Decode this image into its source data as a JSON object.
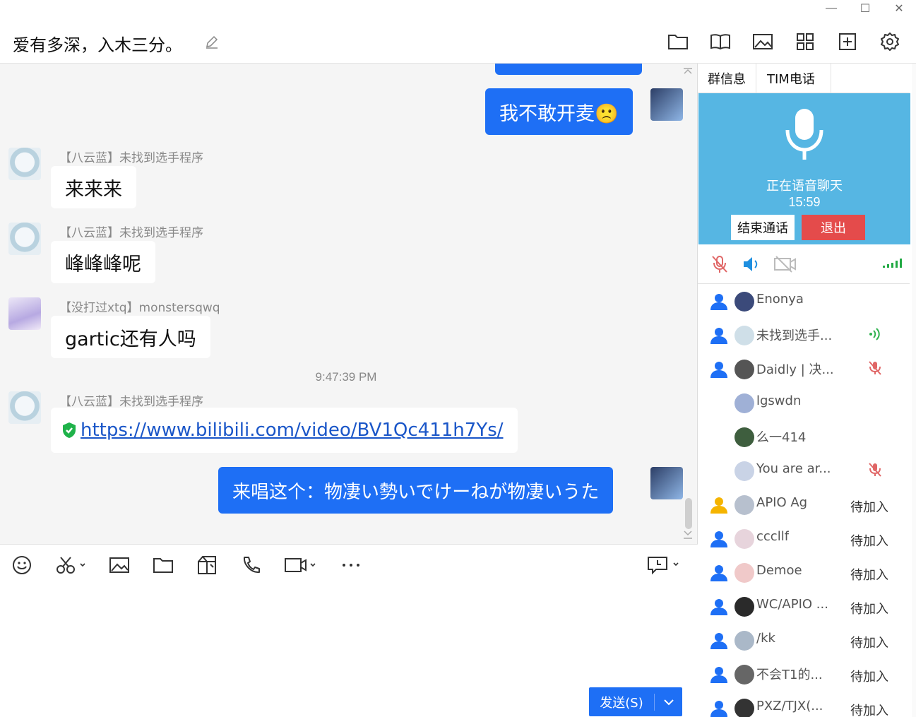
{
  "window": {
    "minimize": "—",
    "maximize": "☐",
    "close": "✕"
  },
  "header": {
    "title": "爱有多深，入木三分。"
  },
  "messages": [
    {
      "nick": "【八云蓝】未找到选手程序",
      "text": "来来来"
    },
    {
      "nick": "【八云蓝】未找到选手程序",
      "text": "峰峰峰呢"
    },
    {
      "nick": "【没打过xtq】monstersqwq",
      "text": "gartic还有人吗"
    },
    {
      "nick": "【八云蓝】未找到选手程序",
      "text": "https://www.bilibili.com/video/BV1Qc411h7Ys/"
    }
  ],
  "outgoing": [
    {
      "text": "我不敢开麦🙁"
    },
    {
      "text": "来唱这个：物凄い勢いでけーねが物凄いうた"
    }
  ],
  "timestamp": "9:47:39 PM",
  "send": {
    "label": "发送(S)"
  },
  "tabs": [
    "群信息",
    "TIM电话"
  ],
  "voice": {
    "status": "正在语音聊天",
    "timer": "15:59",
    "end_label": "结束通话",
    "exit_label": "退出"
  },
  "members": [
    {
      "name": "Enonya",
      "status": "",
      "icon": "none",
      "role": "member"
    },
    {
      "name": "未找到选手...",
      "status": "",
      "icon": "speaking",
      "role": "member"
    },
    {
      "name": "Daidly | 决...",
      "status": "",
      "icon": "muted",
      "role": "member"
    },
    {
      "name": "lgswdn",
      "status": "",
      "icon": "none",
      "role": "none"
    },
    {
      "name": "么一414",
      "status": "",
      "icon": "none",
      "role": "none"
    },
    {
      "name": "You are ar...",
      "status": "",
      "icon": "muted",
      "role": "none"
    },
    {
      "name": "APIO Ag",
      "status": "待加入",
      "icon": "none",
      "role": "owner"
    },
    {
      "name": "cccllf",
      "status": "待加入",
      "icon": "none",
      "role": "member"
    },
    {
      "name": "Demoe",
      "status": "待加入",
      "icon": "none",
      "role": "member"
    },
    {
      "name": "WC/APIO ...",
      "status": "待加入",
      "icon": "none",
      "role": "member"
    },
    {
      "name": "/kk",
      "status": "待加入",
      "icon": "none",
      "role": "member"
    },
    {
      "name": "不会T1的...",
      "status": "待加入",
      "icon": "none",
      "role": "member"
    },
    {
      "name": "PXZ/TJX(...",
      "status": "待加入",
      "icon": "none",
      "role": "member"
    }
  ],
  "colors": {
    "accent": "#1e6ff5",
    "voice_bg": "#56b6e3",
    "exit": "#e44b4b",
    "signal": "#22aa44"
  }
}
